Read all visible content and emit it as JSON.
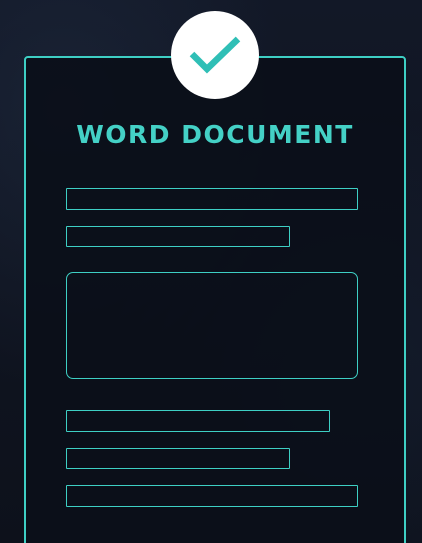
{
  "document": {
    "title": "WORD DOCUMENT",
    "status_icon": "checkmark-icon"
  },
  "colors": {
    "accent": "#3ecfc4",
    "title": "#44d1c6",
    "background": "#0f131f",
    "badge": "#ffffff"
  }
}
